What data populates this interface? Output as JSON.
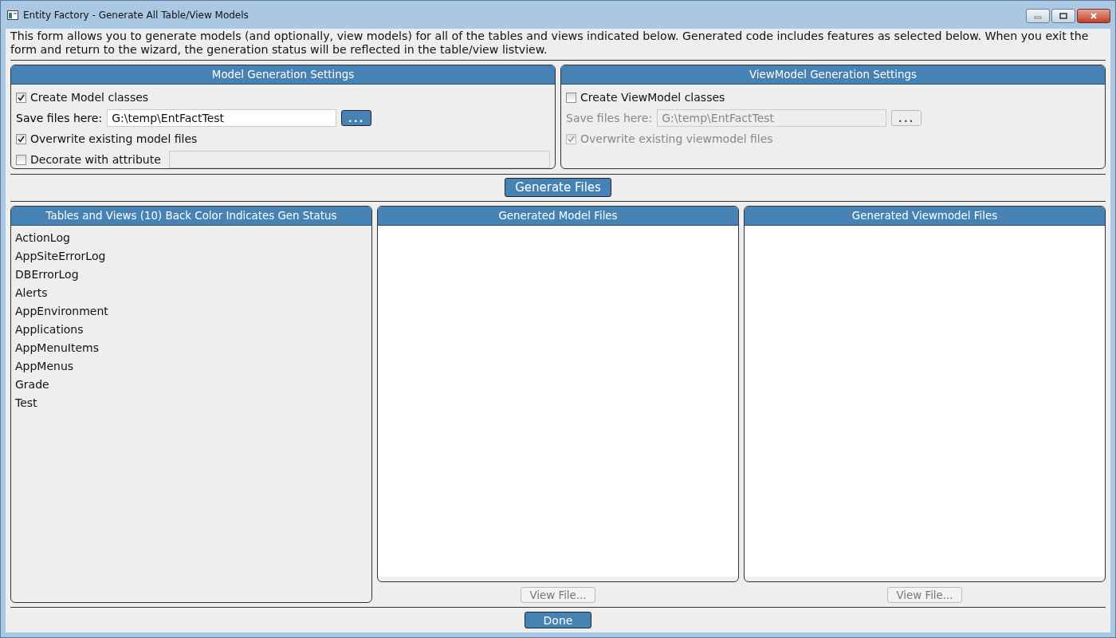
{
  "window": {
    "title": "Entity Factory - Generate All Table/View Models"
  },
  "description": "This form allows you to generate models (and optionally, view models) for all of the tables and views indicated below. Generated code includes features as selected below. When you exit the form and return to the wizard, the generation status will be reflected in the table/view listview.",
  "settings": [
    {
      "title": "Model Generation Settings",
      "create": {
        "label": "Create Model classes",
        "checked": true,
        "disabled": false
      },
      "save_label": "Save files here:",
      "path": "G:\\temp\\EntFactTest",
      "browse": "...",
      "path_disabled": false,
      "overwrite": {
        "label": "Overwrite existing model files",
        "checked": true,
        "disabled": false
      },
      "decorate": {
        "label": "Decorate with attribute",
        "checked": false,
        "disabled": false
      }
    },
    {
      "title": "ViewModel Generation Settings",
      "create": {
        "label": "Create ViewModel classes",
        "checked": false,
        "disabled": false
      },
      "save_label": "Save files here:",
      "path": "G:\\temp\\EntFactTest",
      "browse": "...",
      "path_disabled": true,
      "overwrite": {
        "label": "Overwrite existing viewmodel files",
        "checked": true,
        "disabled": true
      }
    }
  ],
  "generate_button": "Generate Files",
  "tables": {
    "title": "Tables and Views (10) Back Color Indicates Gen Status",
    "items": [
      "ActionLog",
      "AppSiteErrorLog",
      "DBErrorLog",
      "Alerts",
      "AppEnvironment",
      "Applications",
      "AppMenuItems",
      "AppMenus",
      "Grade",
      "Test"
    ]
  },
  "file_lists": [
    {
      "title": "Generated Model Files",
      "view_button": {
        "label": "View File...",
        "disabled": true
      }
    },
    {
      "title": "Generated Viewmodel Files",
      "view_button": {
        "label": "View File...",
        "disabled": true
      }
    }
  ],
  "done_button": "Done"
}
